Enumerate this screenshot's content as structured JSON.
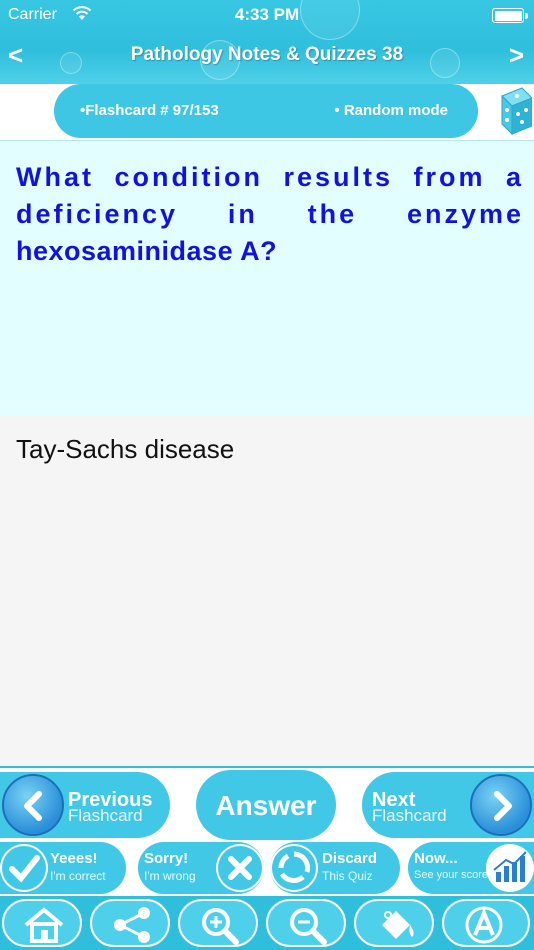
{
  "status_bar": {
    "carrier": "Carrier",
    "time": "4:33 PM"
  },
  "nav": {
    "back": "<",
    "title": "Pathology Notes & Quizzes 38",
    "forward": ">"
  },
  "info": {
    "flashcard": "•Flashcard #  97/153",
    "mode": "• Random mode"
  },
  "question": {
    "line1": "What condition results from a",
    "line2": "deficiency in the enzyme",
    "line3": "hexosaminidase A?"
  },
  "answer": {
    "text": "Tay-Sachs disease"
  },
  "controls": {
    "previous_title": "Previous",
    "previous_sub": "Flashcard",
    "answer_label": "Answer",
    "next_title": "Next",
    "next_sub": "Flashcard"
  },
  "feedback": {
    "yes_title": "Yeees!",
    "yes_sub": "I'm correct",
    "sorry_title": "Sorry!",
    "sorry_sub": "I'm wrong",
    "discard_title": "Discard",
    "discard_sub": "This Quiz",
    "now_title": "Now...",
    "now_sub": "See your score"
  },
  "toolbar_icons": [
    "home-icon",
    "share-icon",
    "zoom-in-icon",
    "zoom-out-icon",
    "paint-bucket-icon",
    "font-icon"
  ],
  "colors": {
    "accent": "#2fbfdc",
    "question_bg": "#e3fefe",
    "question_text": "#1212dd"
  }
}
